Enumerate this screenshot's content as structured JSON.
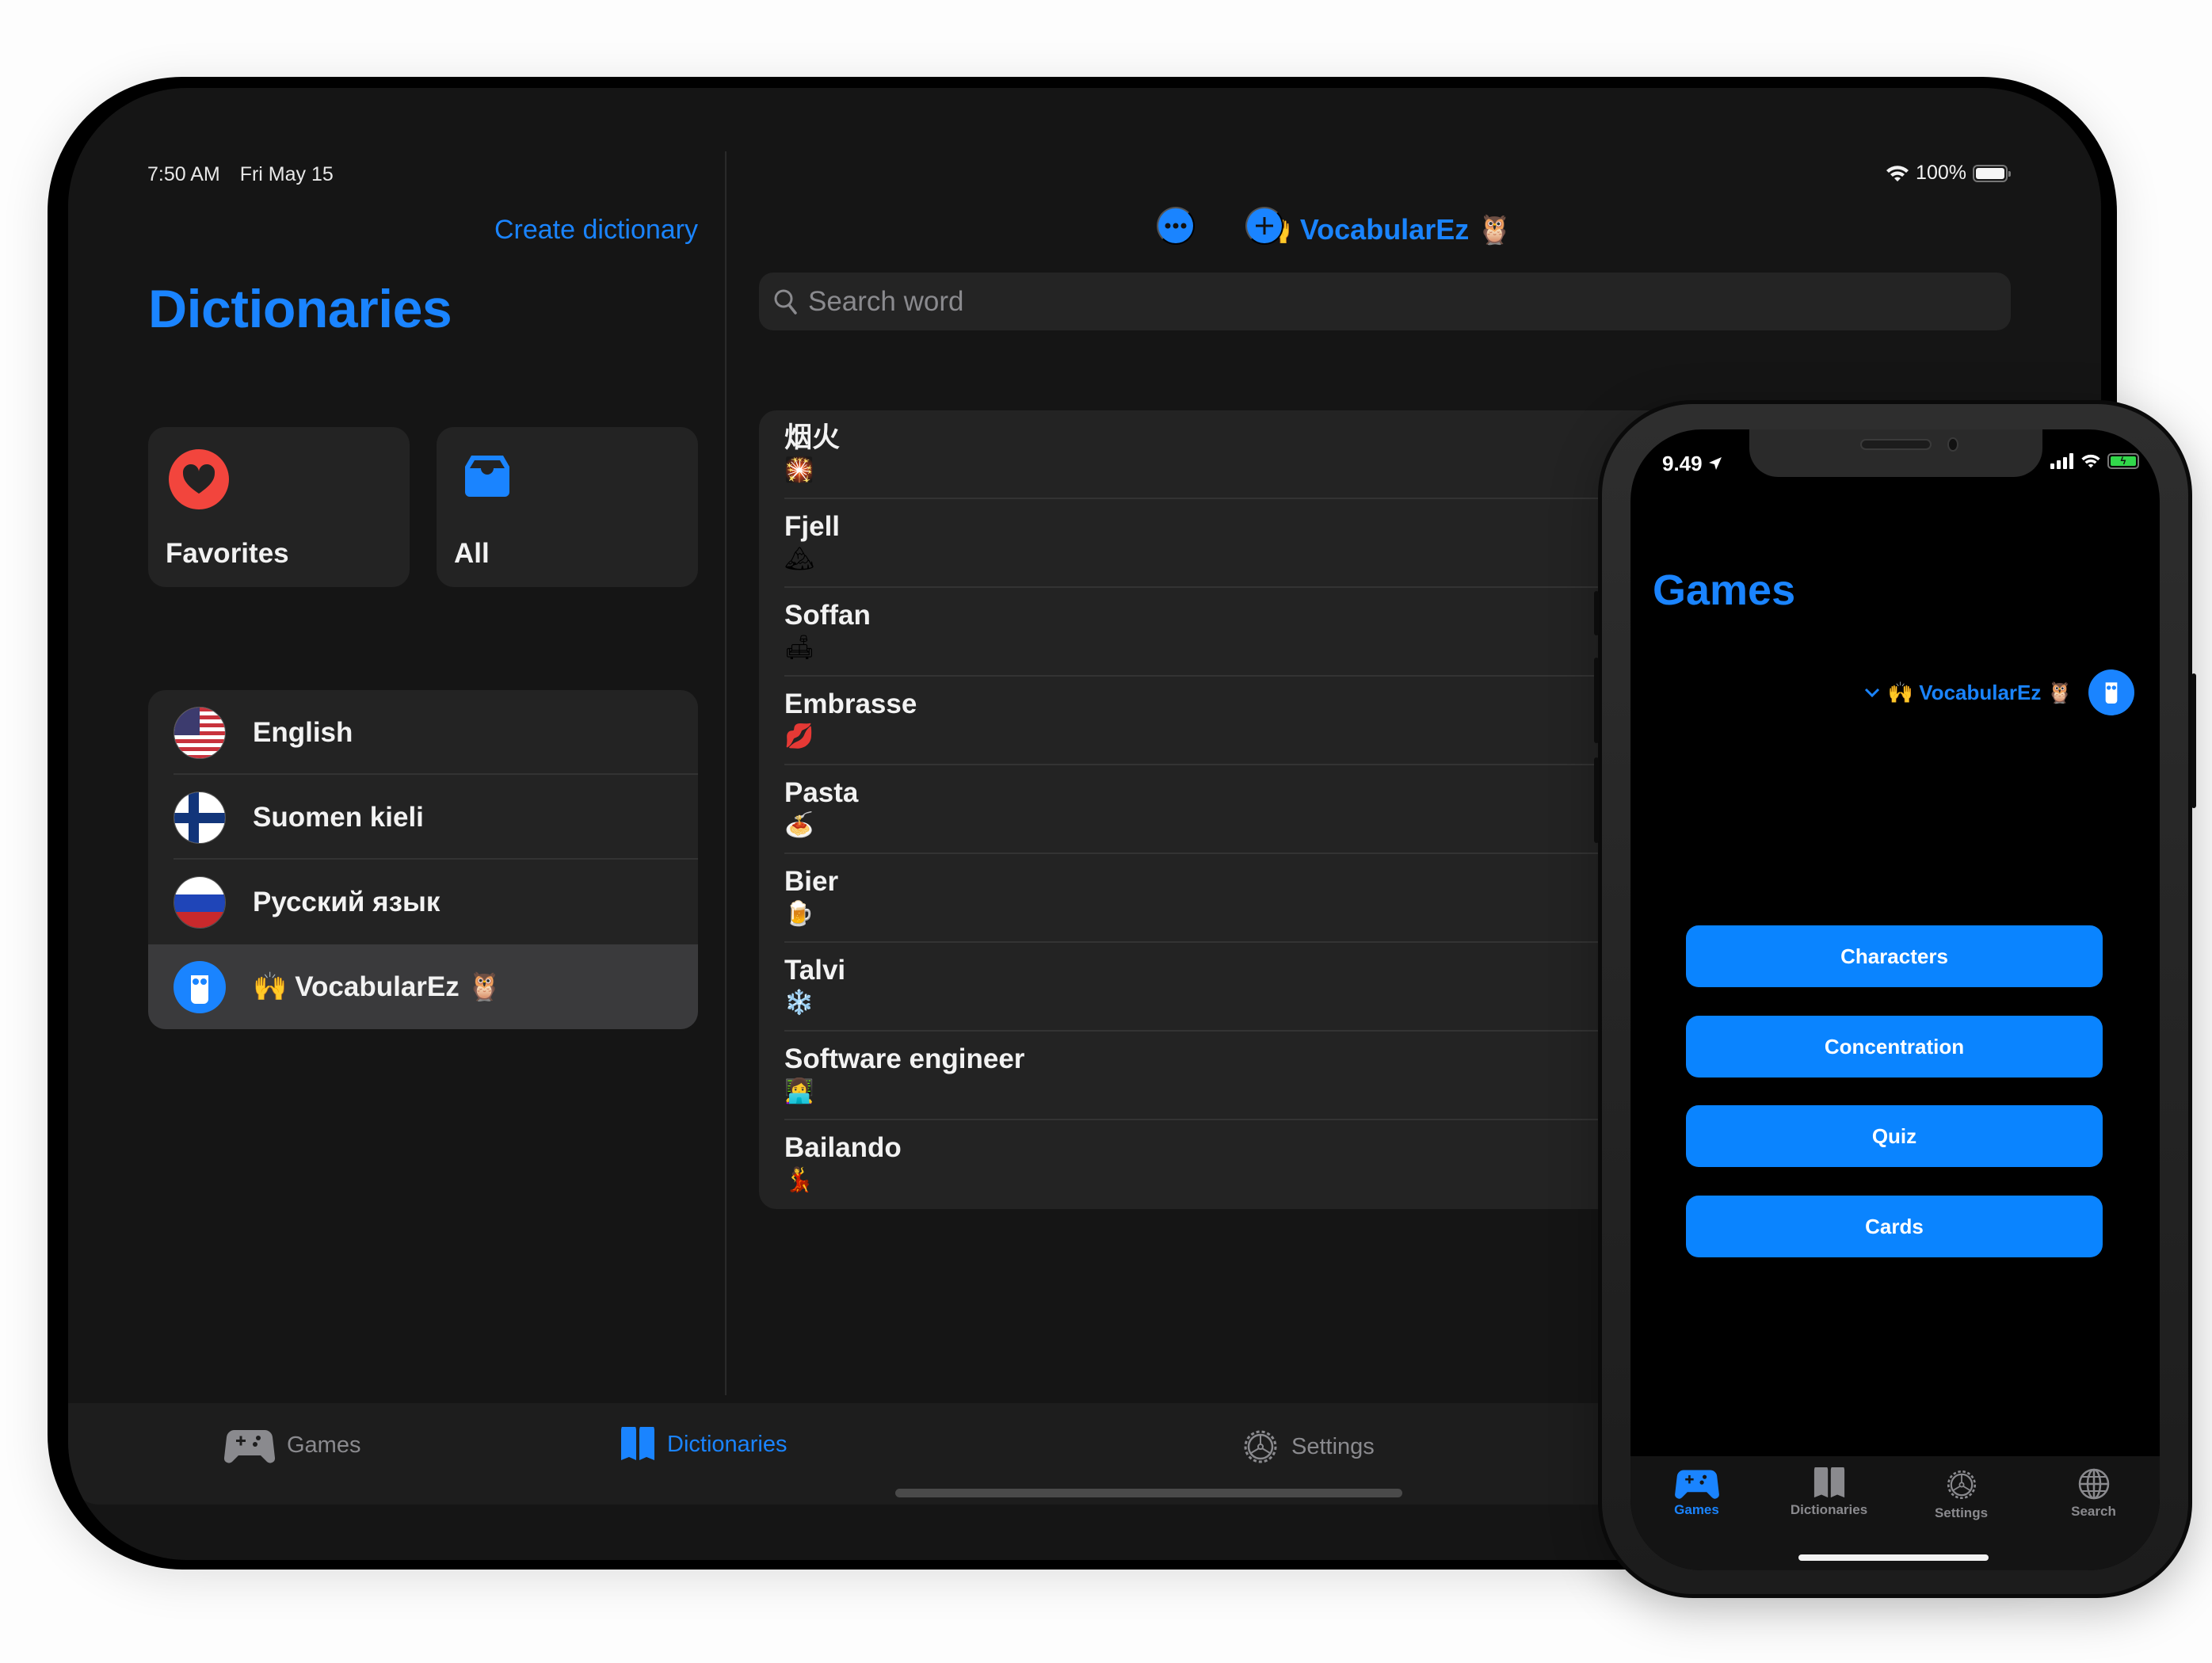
{
  "ipad": {
    "status_bar": {
      "time": "7:50 AM",
      "date": "Fri May 15",
      "battery_percent": "100%",
      "battery_level": 1.0
    },
    "sidebar": {
      "create_button": "Create dictionary",
      "title": "Dictionaries",
      "tiles": [
        {
          "label": "Favorites",
          "icon": "heart-icon",
          "color": "#f2453d"
        },
        {
          "label": "All",
          "icon": "tray-icon",
          "color": "#1a84ff"
        }
      ],
      "dictionaries": [
        {
          "label": "English",
          "icon": "us-flag-icon",
          "selected": false
        },
        {
          "label": "Suomen kieli",
          "icon": "finland-flag-icon",
          "selected": false
        },
        {
          "label": "Русский язык",
          "icon": "russia-flag-icon",
          "selected": false
        },
        {
          "label": "🙌 VocabularEz 🦉",
          "icon": "owl-app-icon",
          "selected": true
        }
      ]
    },
    "detail": {
      "title": "🙌 VocabularEz 🦉",
      "more_button": "more-icon",
      "add_button": "plus-icon",
      "search_placeholder": "Search word",
      "search_value": "",
      "words": [
        {
          "word": "烟火",
          "emoji": "🎇"
        },
        {
          "word": "Fjell",
          "emoji": "🏔"
        },
        {
          "word": "Soffan",
          "emoji": "🛋"
        },
        {
          "word": "Embrasse",
          "emoji": "💋"
        },
        {
          "word": "Pasta",
          "emoji": "🍝"
        },
        {
          "word": "Bier",
          "emoji": "🍺"
        },
        {
          "word": "Talvi",
          "emoji": "❄️"
        },
        {
          "word": "Software engineer",
          "emoji": "👩‍💻"
        },
        {
          "word": "Bailando",
          "emoji": "💃"
        }
      ]
    },
    "tab_bar": [
      {
        "label": "Games",
        "icon": "gamecontroller-icon",
        "active": false
      },
      {
        "label": "Dictionaries",
        "icon": "book-icon",
        "active": true
      },
      {
        "label": "Settings",
        "icon": "gear-icon",
        "active": false
      }
    ]
  },
  "iphone": {
    "status_bar": {
      "time": "9.49",
      "location_active": true,
      "charging": true
    },
    "title": "Games",
    "dictionary_picker": "🙌 VocabularEz 🦉",
    "games": [
      "Characters",
      "Concentration",
      "Quiz",
      "Cards"
    ],
    "tab_bar": [
      {
        "label": "Games",
        "icon": "gamecontroller-icon",
        "active": true
      },
      {
        "label": "Dictionaries",
        "icon": "book-icon",
        "active": false
      },
      {
        "label": "Settings",
        "icon": "gear-icon",
        "active": false
      },
      {
        "label": "Search",
        "icon": "globe-icon",
        "active": false
      }
    ]
  },
  "colors": {
    "accent": "#1a84ff",
    "button": "#0a84ff",
    "background_ipad": "#151515",
    "background_iphone": "#000000",
    "cell": "#232323",
    "favorites": "#f2453d"
  }
}
